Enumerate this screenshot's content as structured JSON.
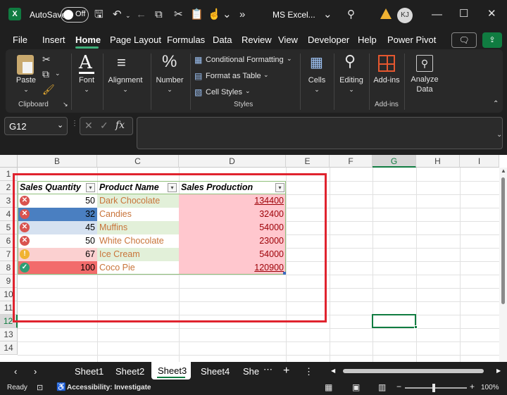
{
  "titlebar": {
    "autosave_label": "AutoSave",
    "autosave_state": "Off",
    "file_title": "MS Excel...",
    "user_initials": "KJ"
  },
  "menu": {
    "items": [
      "File",
      "Insert",
      "Home",
      "Page Layout",
      "Formulas",
      "Data",
      "Review",
      "View",
      "Developer",
      "Help",
      "Power Pivot"
    ],
    "active": "Home"
  },
  "ribbon": {
    "paste": "Paste",
    "clipboard": "Clipboard",
    "font": "Font",
    "alignment": "Alignment",
    "number": "Number",
    "conditional_formatting": "Conditional Formatting",
    "format_as_table": "Format as Table",
    "cell_styles": "Cell Styles",
    "styles": "Styles",
    "cells": "Cells",
    "editing": "Editing",
    "addins": "Add-ins",
    "addins_group": "Add-ins",
    "analyze_data_line1": "Analyze",
    "analyze_data_line2": "Data"
  },
  "formula_bar": {
    "name_box": "G12",
    "fx": "fx",
    "content": ""
  },
  "columns": [
    "B",
    "C",
    "D",
    "E",
    "F",
    "G",
    "H",
    "I"
  ],
  "rows": [
    "1",
    "2",
    "3",
    "4",
    "5",
    "6",
    "7",
    "8",
    "9",
    "10",
    "11",
    "12",
    "13",
    "14"
  ],
  "table": {
    "headers": [
      "Sales Quantity",
      "Product Name",
      "Sales Production"
    ],
    "rows": [
      {
        "qty": "50",
        "name": "Dark Chocolate",
        "prod": "134400",
        "icon": "x"
      },
      {
        "qty": "32",
        "name": "Candies",
        "prod": "32400",
        "icon": "x"
      },
      {
        "qty": "45",
        "name": "Muffins",
        "prod": "54000",
        "icon": "x"
      },
      {
        "qty": "50",
        "name": "White Chocolate",
        "prod": "23000",
        "icon": "x"
      },
      {
        "qty": "67",
        "name": "Ice Cream",
        "prod": "54000",
        "icon": "!"
      },
      {
        "qty": "100",
        "name": "Coco Pie",
        "prod": "120900",
        "icon": "check"
      }
    ]
  },
  "sheets": {
    "tabs": [
      "Sheet1",
      "Sheet2",
      "Sheet3",
      "Sheet4",
      "She"
    ],
    "active": "Sheet3"
  },
  "status": {
    "ready": "Ready",
    "accessibility": "Accessibility: Investigate",
    "zoom": "100%"
  },
  "colors": {
    "accent_green": "#107c41",
    "annotation_red": "#e0232e",
    "icon_red": "#d9534f",
    "icon_yellow": "#f0b232",
    "icon_green": "#2e9e74"
  }
}
